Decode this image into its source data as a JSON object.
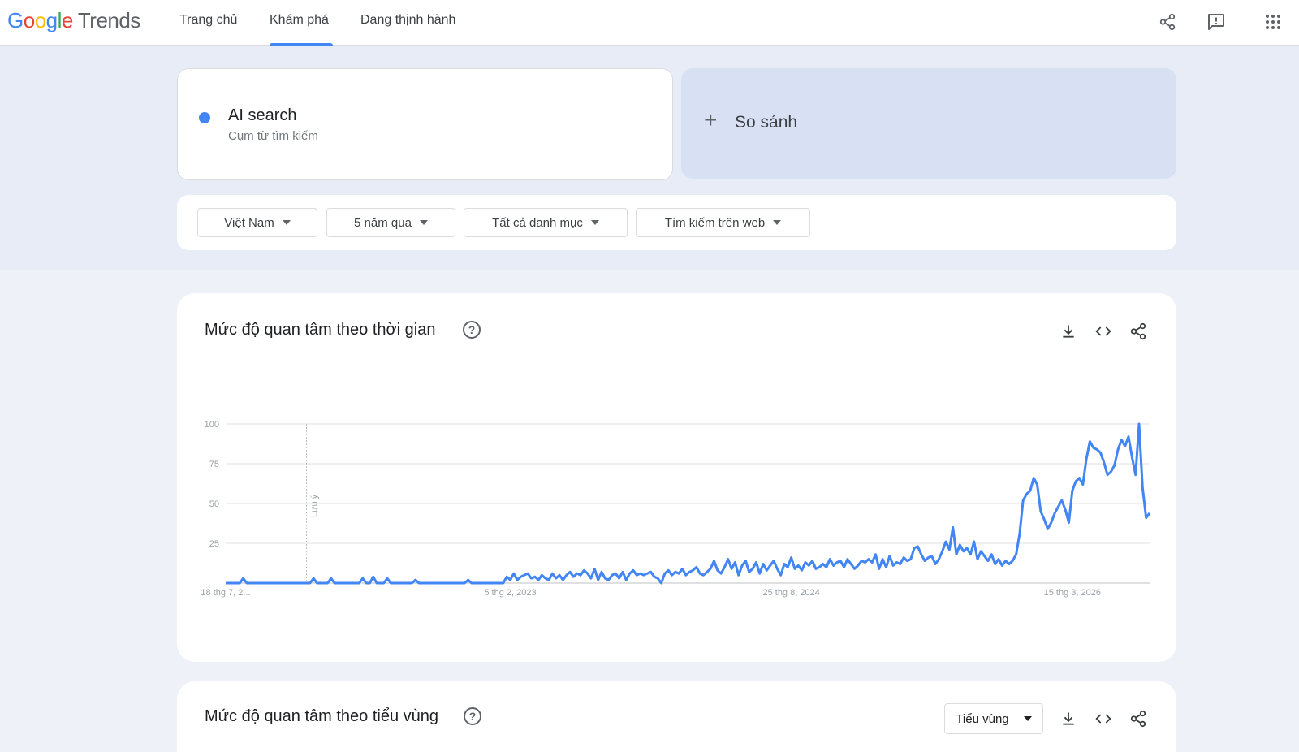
{
  "header": {
    "logo_google": "Google",
    "logo_product": "Trends",
    "tabs": [
      {
        "label": "Trang chủ",
        "active": false
      },
      {
        "label": "Khám phá",
        "active": true
      },
      {
        "label": "Đang thịnh hành",
        "active": false
      }
    ],
    "icons": [
      "share-icon",
      "feedback-icon",
      "apps-grid-icon"
    ]
  },
  "search": {
    "term": "AI search",
    "term_type": "Cụm từ tìm kiếm",
    "term_color": "#4285f4",
    "compare_label": "So sánh"
  },
  "filters": [
    {
      "label": "Việt Nam"
    },
    {
      "label": "5 năm qua"
    },
    {
      "label": "Tất cả danh mục"
    },
    {
      "label": "Tìm kiếm trên web"
    }
  ],
  "interest_over_time": {
    "title": "Mức độ quan tâm theo thời gian",
    "icons": [
      "download-icon",
      "embed-code-icon",
      "share-icon"
    ]
  },
  "chart_data": {
    "type": "line",
    "title": "",
    "xlabel": "",
    "ylabel": "",
    "ylim": [
      0,
      100
    ],
    "yticks": [
      25,
      50,
      75,
      100
    ],
    "xtick_labels": [
      "18 thg 7, 2...",
      "5 thg 2, 2023",
      "25 thg 8, 2024",
      "15 thg 3, 2026"
    ],
    "xtick_indices": [
      0,
      81,
      161,
      241
    ],
    "annotation": {
      "label": "Lưu ý",
      "index": 23
    },
    "grid": true,
    "line_color": "#4285f4",
    "series": [
      {
        "name": "AI search",
        "values": [
          0,
          0,
          0,
          0,
          0,
          3,
          0,
          0,
          0,
          0,
          0,
          0,
          0,
          0,
          0,
          0,
          0,
          0,
          0,
          0,
          0,
          0,
          0,
          0,
          0,
          3,
          0,
          0,
          0,
          0,
          3,
          0,
          0,
          0,
          0,
          0,
          0,
          0,
          0,
          3,
          0,
          0,
          4,
          0,
          0,
          0,
          3,
          0,
          0,
          0,
          0,
          0,
          0,
          0,
          2,
          0,
          0,
          0,
          0,
          0,
          0,
          0,
          0,
          0,
          0,
          0,
          0,
          0,
          0,
          2,
          0,
          0,
          0,
          0,
          0,
          0,
          0,
          0,
          0,
          0,
          4,
          2,
          6,
          2,
          4,
          5,
          6,
          3,
          4,
          2,
          5,
          3,
          2,
          6,
          3,
          5,
          2,
          5,
          7,
          4,
          6,
          5,
          8,
          6,
          3,
          9,
          2,
          7,
          3,
          2,
          5,
          6,
          3,
          7,
          2,
          6,
          8,
          5,
          6,
          5,
          6,
          7,
          4,
          3,
          0,
          6,
          8,
          5,
          7,
          6,
          9,
          5,
          7,
          8,
          10,
          6,
          5,
          7,
          9,
          14,
          8,
          6,
          10,
          15,
          9,
          13,
          5,
          11,
          14,
          7,
          9,
          13,
          6,
          12,
          8,
          11,
          14,
          9,
          5,
          12,
          10,
          16,
          9,
          11,
          8,
          13,
          11,
          14,
          9,
          10,
          12,
          10,
          15,
          11,
          13,
          14,
          10,
          15,
          12,
          9,
          11,
          14,
          13,
          15,
          13,
          18,
          9,
          15,
          10,
          17,
          11,
          13,
          12,
          16,
          14,
          15,
          22,
          23,
          18,
          14,
          16,
          17,
          12,
          15,
          20,
          26,
          21,
          35,
          18,
          24,
          20,
          22,
          18,
          26,
          15,
          20,
          17,
          14,
          18,
          12,
          15,
          11,
          14,
          12,
          14,
          18,
          31,
          52,
          56,
          58,
          66,
          62,
          45,
          40,
          34,
          38,
          44,
          48,
          52,
          46,
          38,
          58,
          64,
          66,
          62,
          78,
          89,
          85,
          84,
          82,
          76,
          68,
          70,
          74,
          84,
          90,
          86,
          92,
          79,
          68,
          100,
          60,
          41,
          44
        ]
      }
    ]
  },
  "interest_by_region": {
    "title": "Mức độ quan tâm theo tiểu vùng",
    "select_label": "Tiểu vùng",
    "icons": [
      "download-icon",
      "embed-code-icon",
      "share-icon"
    ]
  }
}
